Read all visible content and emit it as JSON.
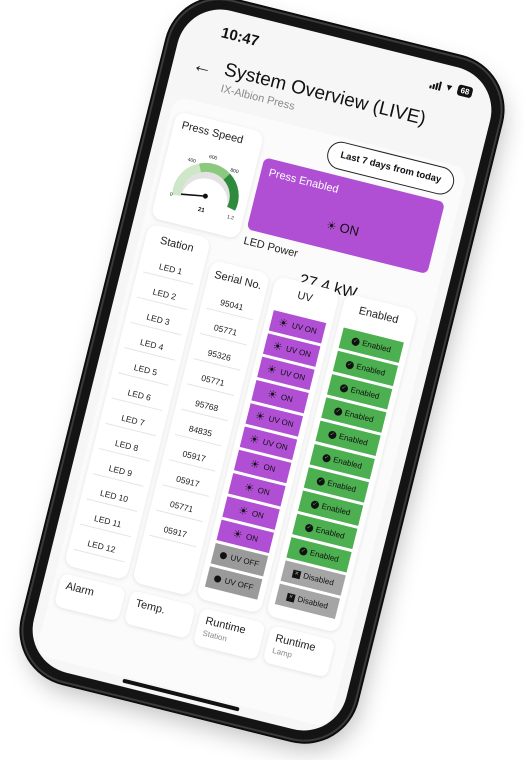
{
  "status": {
    "time": "10:47",
    "battery": "68"
  },
  "header": {
    "back_icon": "back-arrow-icon",
    "title": "System Overview (LIVE)",
    "subtitle": "IX-Albion Press"
  },
  "date_range_button": "Last 7 days from today",
  "press_speed": {
    "label": "Press Speed",
    "value": "21",
    "gauge_ticks": [
      "0",
      "400",
      "600",
      "800",
      "1.2"
    ],
    "gauge_max_label": "1.2"
  },
  "press_enabled": {
    "label": "Press Enabled",
    "value": "ON",
    "color": "#b04fd4"
  },
  "led_power": {
    "label": "LED Power",
    "value": "27.4 kW"
  },
  "table": {
    "headers": {
      "station": "Station",
      "serial": "Serial No.",
      "uv": "UV",
      "enabled": "Enabled"
    },
    "stations": [
      "LED 1",
      "LED 2",
      "LED 3",
      "LED 4",
      "LED 5",
      "LED 6",
      "LED 7",
      "LED 8",
      "LED 9",
      "LED 10",
      "LED 11",
      "LED 12"
    ],
    "serials": [
      "95041",
      "05771",
      "95326",
      "05771",
      "95768",
      "84835",
      "05917",
      "05917",
      "05771",
      "05917"
    ],
    "uv": [
      {
        "state": "on",
        "text": "UV ON"
      },
      {
        "state": "on",
        "text": "UV ON"
      },
      {
        "state": "on",
        "text": "UV ON"
      },
      {
        "state": "on",
        "text": "ON"
      },
      {
        "state": "on",
        "text": "UV ON"
      },
      {
        "state": "on",
        "text": "UV ON"
      },
      {
        "state": "on",
        "text": "ON"
      },
      {
        "state": "on",
        "text": "ON"
      },
      {
        "state": "on",
        "text": "ON"
      },
      {
        "state": "on",
        "text": "ON"
      },
      {
        "state": "off",
        "text": "UV OFF"
      },
      {
        "state": "off",
        "text": "UV OFF"
      }
    ],
    "enabled": [
      {
        "state": "on",
        "text": "Enabled"
      },
      {
        "state": "on",
        "text": "Enabled"
      },
      {
        "state": "on",
        "text": "Enabled"
      },
      {
        "state": "on",
        "text": "Enabled"
      },
      {
        "state": "on",
        "text": "Enabled"
      },
      {
        "state": "on",
        "text": "Enabled"
      },
      {
        "state": "on",
        "text": "Enabled"
      },
      {
        "state": "on",
        "text": "Enabled"
      },
      {
        "state": "on",
        "text": "Enabled"
      },
      {
        "state": "on",
        "text": "Enabled"
      },
      {
        "state": "off",
        "text": "Disabled"
      },
      {
        "state": "off",
        "text": "Disabled"
      }
    ]
  },
  "footer": {
    "alarm": "Alarm",
    "temp": "Temp.",
    "runtime_station": {
      "title": "Runtime",
      "sub": "Station"
    },
    "runtime_lamp": {
      "title": "Runtime",
      "sub": "Lamp"
    }
  },
  "colors": {
    "uv_on": "#b04fd4",
    "uv_off": "#9a9a9a",
    "enabled": "#4caf50",
    "disabled": "#a5a5a5",
    "gauge": "#2e8b3e"
  }
}
